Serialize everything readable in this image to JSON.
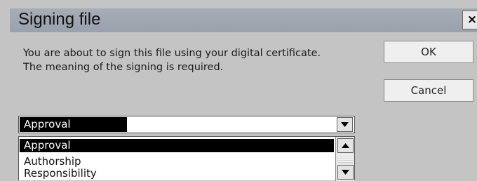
{
  "dialog": {
    "title": "Signing file",
    "close_label": "×",
    "message_lines": [
      "You are about to sign this file using your digital certificate.",
      "The meaning of the signing is required."
    ]
  },
  "buttons": {
    "ok_label": "OK",
    "cancel_label": "Cancel"
  },
  "meaning_select": {
    "selected_value": "Approval",
    "options": [
      "Approval",
      "Authorship",
      "Responsibility"
    ],
    "highlighted_index": 0
  },
  "icons": {
    "close": "close-icon",
    "dropdown": "chevron-down-icon",
    "scroll_up": "arrow-up-icon",
    "scroll_down": "arrow-down-icon"
  }
}
